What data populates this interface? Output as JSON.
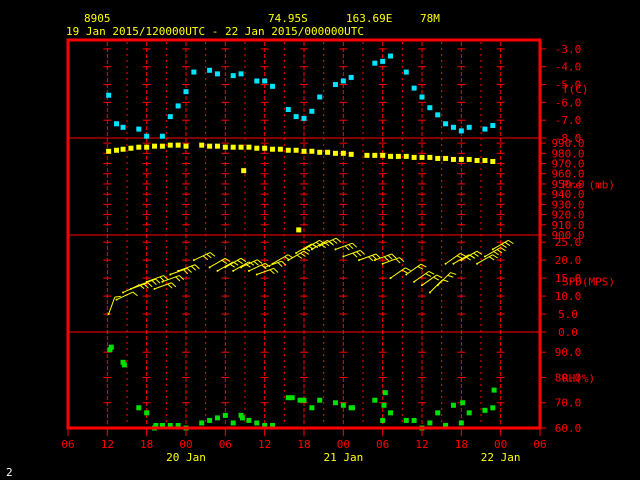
{
  "header": {
    "station_id": "8905",
    "lat": "74.95S",
    "lon": "163.69E",
    "elev": "78M",
    "time_range": "19 Jan 2015/120000UTC - 22 Jan 2015/000000UTC"
  },
  "footer": {
    "page": "2"
  },
  "x_axis": {
    "tick_labels": [
      "06",
      "12",
      "18",
      "00",
      "06",
      "12",
      "18",
      "00",
      "06",
      "12",
      "18",
      "00",
      "06"
    ],
    "tick_hours": [
      -6,
      0,
      6,
      12,
      18,
      24,
      30,
      36,
      42,
      48,
      54,
      60,
      66
    ],
    "day_labels": [
      {
        "label": "20 Jan",
        "hour": 12
      },
      {
        "label": "21 Jan",
        "hour": 36
      },
      {
        "label": "22 Jan",
        "hour": 60
      }
    ]
  },
  "colors": {
    "frame": "#ff0000",
    "header_text": "#ffff00",
    "axis_text": "#ff0000",
    "temperature": "#00e5ff",
    "pressure": "#ffff00",
    "wind": "#ffff00",
    "rh": "#00e000",
    "footer_text": "#ffffff"
  },
  "chart_data": [
    {
      "type": "scatter",
      "ylabel": "T(C)",
      "ylim": [
        -8,
        -2.5
      ],
      "yticks": [
        -8,
        -7,
        -6,
        -5,
        -4,
        -3
      ],
      "ytick_labels": [
        "-8.0",
        "-7.0",
        "-6.0",
        "-5.0",
        "-4.0",
        "-3.0"
      ],
      "x": [
        0.2,
        1.4,
        2.4,
        4.8,
        6.0,
        8.4,
        9.6,
        10.8,
        12.0,
        13.2,
        15.6,
        16.8,
        19.2,
        20.4,
        22.8,
        24.0,
        25.2,
        27.6,
        28.8,
        30.0,
        31.2,
        32.4,
        34.8,
        36.0,
        37.2,
        40.8,
        42.0,
        43.2,
        45.6,
        46.8,
        48.0,
        49.2,
        50.4,
        51.6,
        52.8,
        54.0,
        55.2,
        57.6,
        58.8
      ],
      "y": [
        -5.6,
        -7.2,
        -7.4,
        -7.5,
        -7.9,
        -7.9,
        -6.8,
        -6.2,
        -5.4,
        -4.3,
        -4.2,
        -4.4,
        -4.5,
        -4.4,
        -4.8,
        -4.8,
        -5.1,
        -6.4,
        -6.8,
        -6.9,
        -6.5,
        -5.7,
        -5.0,
        -4.8,
        -4.6,
        -3.8,
        -3.7,
        -3.4,
        -4.3,
        -5.2,
        -5.7,
        -6.3,
        -6.7,
        -7.2,
        -7.4,
        -7.6,
        -7.4,
        -7.5,
        -7.3
      ]
    },
    {
      "type": "scatter",
      "ylabel": "Pre (mb)",
      "ylim": [
        900,
        995
      ],
      "yticks": [
        900,
        910,
        920,
        930,
        940,
        950,
        960,
        970,
        980,
        990
      ],
      "ytick_labels": [
        "900.0",
        "910.0",
        "920.0",
        "930.0",
        "940.0",
        "950.0",
        "960.0",
        "970.0",
        "980.0",
        "990.0"
      ],
      "x": [
        0.2,
        1.4,
        2.4,
        3.6,
        4.8,
        6.0,
        7.2,
        8.4,
        9.6,
        10.8,
        12.0,
        14.4,
        15.6,
        16.8,
        18.0,
        19.2,
        20.4,
        21.6,
        22.8,
        24.0,
        25.2,
        26.4,
        27.6,
        28.8,
        30.0,
        31.2,
        32.4,
        33.6,
        34.8,
        36.0,
        37.2,
        39.6,
        40.8,
        42.0,
        43.2,
        44.4,
        45.6,
        46.8,
        48.0,
        49.2,
        50.4,
        51.6,
        52.8,
        54.0,
        55.2,
        56.4,
        57.6,
        58.8,
        20.8,
        29.2
      ],
      "y": [
        982,
        983,
        984,
        985,
        986,
        986,
        987,
        987,
        988,
        988,
        987,
        988,
        987,
        987,
        986,
        986,
        986,
        986,
        985,
        985,
        984,
        984,
        983,
        983,
        982,
        982,
        981,
        981,
        980,
        980,
        979,
        978,
        978,
        978,
        977,
        977,
        977,
        976,
        976,
        976,
        975,
        975,
        974,
        974,
        974,
        973,
        973,
        972,
        963,
        905
      ]
    },
    {
      "type": "barbs",
      "ylabel": "SPD(MPS)",
      "ylim": [
        0,
        27
      ],
      "yticks": [
        0,
        5,
        10,
        15,
        20,
        25
      ],
      "ytick_labels": [
        "0.0",
        "5.0",
        "10.0",
        "15.0",
        "20.0",
        "25.0"
      ],
      "x": [
        0.2,
        1.4,
        2.4,
        3.6,
        4.8,
        6.0,
        7.2,
        8.4,
        9.6,
        10.8,
        13.2,
        15.6,
        16.8,
        18.0,
        19.2,
        20.4,
        21.6,
        22.8,
        24.0,
        25.2,
        27.6,
        28.8,
        30.0,
        31.2,
        32.4,
        34.8,
        36.0,
        38.4,
        40.8,
        42.0,
        43.2,
        45.6,
        46.8,
        48.0,
        49.2,
        50.4,
        51.6,
        52.8,
        54.0,
        56.4,
        57.6,
        58.8
      ],
      "speed": [
        5,
        9,
        11,
        12,
        13,
        14,
        12,
        14,
        16,
        17,
        20,
        18,
        17,
        18,
        17,
        18,
        17,
        16,
        18,
        19,
        20,
        22,
        23,
        23,
        24,
        23,
        21,
        20,
        20,
        19,
        15,
        16,
        14,
        13,
        11,
        13,
        19,
        19,
        20,
        19,
        21,
        23
      ],
      "direction": [
        20,
        65,
        65,
        70,
        70,
        70,
        70,
        70,
        70,
        70,
        65,
        60,
        60,
        60,
        60,
        65,
        65,
        70,
        70,
        60,
        60,
        60,
        60,
        60,
        65,
        70,
        70,
        70,
        70,
        70,
        55,
        55,
        55,
        55,
        45,
        45,
        55,
        60,
        60,
        60,
        60,
        60
      ]
    },
    {
      "type": "scatter",
      "ylabel": "RH(%)",
      "ylim": [
        60,
        98
      ],
      "yticks": [
        60,
        70,
        80,
        90
      ],
      "ytick_labels": [
        "60.0",
        "70.0",
        "80.0",
        "90.0"
      ],
      "x": [
        0.4,
        0.6,
        2.4,
        2.6,
        4.8,
        6.0,
        7.2,
        7.4,
        8.4,
        9.6,
        10.8,
        12.0,
        14.4,
        15.6,
        16.8,
        18.0,
        19.2,
        20.4,
        20.6,
        21.6,
        22.8,
        24.0,
        25.2,
        27.6,
        28.2,
        29.4,
        30.0,
        31.2,
        32.4,
        34.8,
        36.0,
        37.2,
        37.4,
        40.8,
        42.0,
        42.2,
        42.4,
        43.2,
        45.6,
        46.8,
        48.0,
        49.2,
        50.4,
        51.6,
        52.8,
        54.0,
        54.2,
        55.2,
        57.6,
        58.8,
        59.0
      ],
      "y": [
        91,
        92,
        86,
        85,
        68,
        66,
        60,
        61,
        61,
        61,
        61,
        60,
        62,
        63,
        64,
        65,
        62,
        65,
        64,
        63,
        62,
        61,
        61,
        72,
        72,
        71,
        71,
        68,
        71,
        70,
        69,
        68,
        68,
        71,
        63,
        69,
        74,
        66,
        63,
        63,
        60,
        62,
        66,
        61,
        69,
        62,
        70,
        66,
        67,
        68,
        75
      ]
    }
  ]
}
